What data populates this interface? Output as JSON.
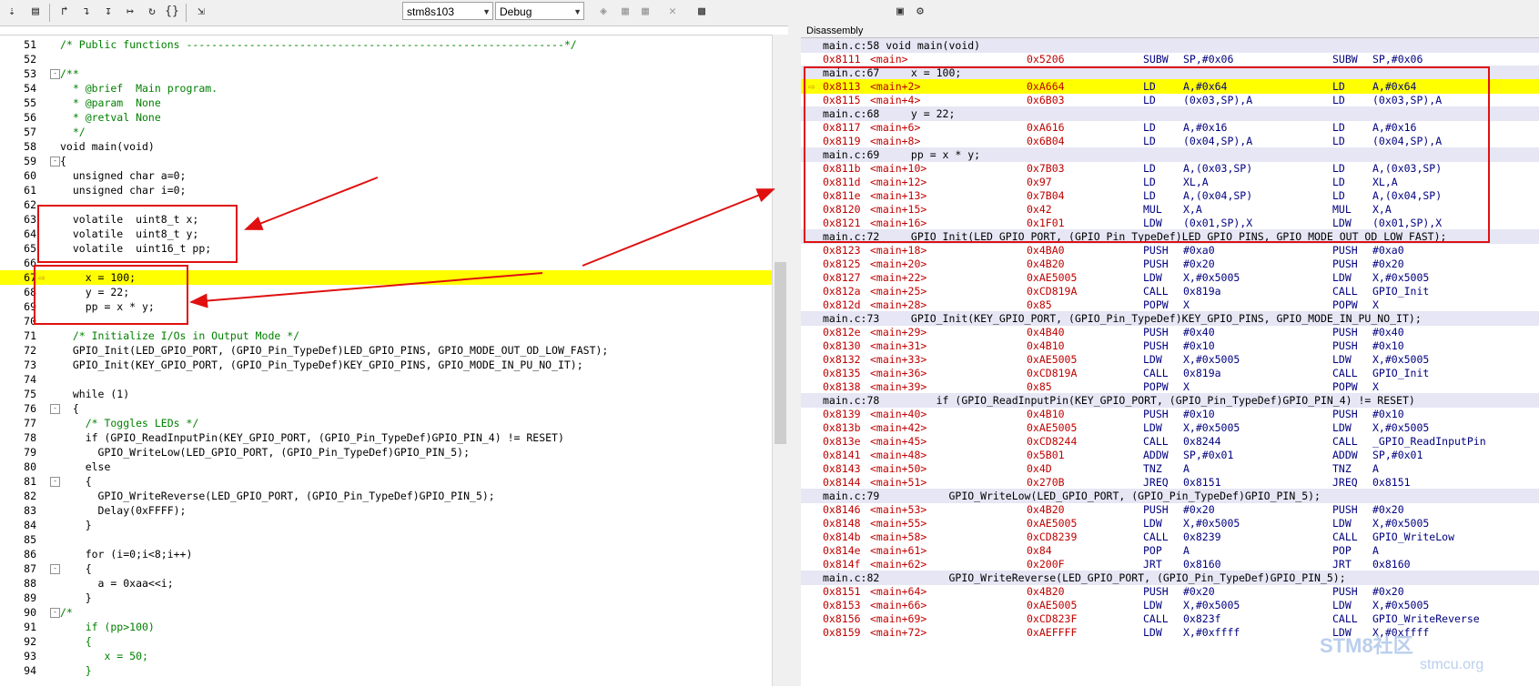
{
  "toolbar": {
    "target_select": "stm8s103",
    "config_select": "Debug",
    "icons": [
      "step-over-icon",
      "step-into-icon",
      "step-out-icon",
      "run-to-cursor-icon",
      "show-next-statement-icon",
      "disassembly-window-icon",
      "memory-window-icon"
    ]
  },
  "editor": {
    "lines": [
      {
        "n": "51",
        "t": "/* Public functions ------------------------------------------------------------*/",
        "k": "comment"
      },
      {
        "n": "52",
        "t": "",
        "k": "code"
      },
      {
        "n": "53",
        "t": "/**",
        "k": "comment",
        "fold": "-"
      },
      {
        "n": "54",
        "t": "  * @brief  Main program.",
        "k": "comment"
      },
      {
        "n": "55",
        "t": "  * @param  None",
        "k": "comment"
      },
      {
        "n": "56",
        "t": "  * @retval None",
        "k": "comment"
      },
      {
        "n": "57",
        "t": "  */",
        "k": "comment"
      },
      {
        "n": "58",
        "t": "void main(void)",
        "k": "code"
      },
      {
        "n": "59",
        "t": "{",
        "k": "code",
        "fold": "-"
      },
      {
        "n": "60",
        "t": "  unsigned char a=0;",
        "k": "code"
      },
      {
        "n": "61",
        "t": "  unsigned char i=0;",
        "k": "code"
      },
      {
        "n": "62",
        "t": "",
        "k": "code"
      },
      {
        "n": "63",
        "t": "  volatile  uint8_t x;",
        "k": "code"
      },
      {
        "n": "64",
        "t": "  volatile  uint8_t y;",
        "k": "code"
      },
      {
        "n": "65",
        "t": "  volatile  uint16_t pp;",
        "k": "code"
      },
      {
        "n": "66",
        "t": "",
        "k": "code"
      },
      {
        "n": "67",
        "t": "    x = 100;",
        "k": "code",
        "cur": true
      },
      {
        "n": "68",
        "t": "    y = 22;",
        "k": "code"
      },
      {
        "n": "69",
        "t": "    pp = x * y;",
        "k": "code"
      },
      {
        "n": "70",
        "t": "",
        "k": "code"
      },
      {
        "n": "71",
        "t": "  /* Initialize I/Os in Output Mode */",
        "k": "comment"
      },
      {
        "n": "72",
        "t": "  GPIO_Init(LED_GPIO_PORT, (GPIO_Pin_TypeDef)LED_GPIO_PINS, GPIO_MODE_OUT_OD_LOW_FAST);",
        "k": "code"
      },
      {
        "n": "73",
        "t": "  GPIO_Init(KEY_GPIO_PORT, (GPIO_Pin_TypeDef)KEY_GPIO_PINS, GPIO_MODE_IN_PU_NO_IT);",
        "k": "code"
      },
      {
        "n": "74",
        "t": "",
        "k": "code"
      },
      {
        "n": "75",
        "t": "  while (1)",
        "k": "code"
      },
      {
        "n": "76",
        "t": "  {",
        "k": "code",
        "fold": "-"
      },
      {
        "n": "77",
        "t": "    /* Toggles LEDs */",
        "k": "comment"
      },
      {
        "n": "78",
        "t": "    if (GPIO_ReadInputPin(KEY_GPIO_PORT, (GPIO_Pin_TypeDef)GPIO_PIN_4) != RESET)",
        "k": "code"
      },
      {
        "n": "79",
        "t": "      GPIO_WriteLow(LED_GPIO_PORT, (GPIO_Pin_TypeDef)GPIO_PIN_5);",
        "k": "code"
      },
      {
        "n": "80",
        "t": "    else",
        "k": "code"
      },
      {
        "n": "81",
        "t": "    {",
        "k": "code",
        "fold": "-"
      },
      {
        "n": "82",
        "t": "      GPIO_WriteReverse(LED_GPIO_PORT, (GPIO_Pin_TypeDef)GPIO_PIN_5);",
        "k": "code"
      },
      {
        "n": "83",
        "t": "      Delay(0xFFFF);",
        "k": "code"
      },
      {
        "n": "84",
        "t": "    }",
        "k": "code"
      },
      {
        "n": "85",
        "t": "",
        "k": "code"
      },
      {
        "n": "86",
        "t": "    for (i=0;i<8;i++)",
        "k": "code"
      },
      {
        "n": "87",
        "t": "    {",
        "k": "code",
        "fold": "-"
      },
      {
        "n": "88",
        "t": "      a = 0xaa<<i;",
        "k": "code"
      },
      {
        "n": "89",
        "t": "    }",
        "k": "code"
      },
      {
        "n": "90",
        "t": "/*",
        "k": "comment",
        "fold": "-"
      },
      {
        "n": "91",
        "t": "    if (pp>100)",
        "k": "comment"
      },
      {
        "n": "92",
        "t": "    {",
        "k": "comment"
      },
      {
        "n": "93",
        "t": "       x = 50;",
        "k": "comment"
      },
      {
        "n": "94",
        "t": "    }",
        "k": "comment"
      }
    ]
  },
  "disassembly": {
    "title": "Disassembly",
    "rows": [
      {
        "type": "src",
        "text": "main.c:58 void main(void)"
      },
      {
        "type": "asm",
        "addr": "0x8111",
        "lab": "<main>",
        "op": "0x5206",
        "mn": "SUBW",
        "arg": "SP,#0x06",
        "mn2": "SUBW",
        "arg2": "SP,#0x06"
      },
      {
        "type": "src",
        "text": "main.c:67     x = 100;"
      },
      {
        "type": "asm",
        "addr": "0x8113",
        "lab": "<main+2>",
        "op": "0xA664",
        "mn": "LD",
        "arg": "A,#0x64",
        "mn2": "LD",
        "arg2": "A,#0x64",
        "cur": true
      },
      {
        "type": "asm",
        "addr": "0x8115",
        "lab": "<main+4>",
        "op": "0x6B03",
        "mn": "LD",
        "arg": "(0x03,SP),A",
        "mn2": "LD",
        "arg2": "(0x03,SP),A"
      },
      {
        "type": "src",
        "text": "main.c:68     y = 22;"
      },
      {
        "type": "asm",
        "addr": "0x8117",
        "lab": "<main+6>",
        "op": "0xA616",
        "mn": "LD",
        "arg": "A,#0x16",
        "mn2": "LD",
        "arg2": "A,#0x16"
      },
      {
        "type": "asm",
        "addr": "0x8119",
        "lab": "<main+8>",
        "op": "0x6B04",
        "mn": "LD",
        "arg": "(0x04,SP),A",
        "mn2": "LD",
        "arg2": "(0x04,SP),A"
      },
      {
        "type": "src",
        "text": "main.c:69     pp = x * y;"
      },
      {
        "type": "asm",
        "addr": "0x811b",
        "lab": "<main+10>",
        "op": "0x7B03",
        "mn": "LD",
        "arg": "A,(0x03,SP)",
        "mn2": "LD",
        "arg2": "A,(0x03,SP)"
      },
      {
        "type": "asm",
        "addr": "0x811d",
        "lab": "<main+12>",
        "op": "0x97",
        "mn": "LD",
        "arg": "XL,A",
        "mn2": "LD",
        "arg2": "XL,A"
      },
      {
        "type": "asm",
        "addr": "0x811e",
        "lab": "<main+13>",
        "op": "0x7B04",
        "mn": "LD",
        "arg": "A,(0x04,SP)",
        "mn2": "LD",
        "arg2": "A,(0x04,SP)"
      },
      {
        "type": "asm",
        "addr": "0x8120",
        "lab": "<main+15>",
        "op": "0x42",
        "mn": "MUL",
        "arg": "X,A",
        "mn2": "MUL",
        "arg2": "X,A"
      },
      {
        "type": "asm",
        "addr": "0x8121",
        "lab": "<main+16>",
        "op": "0x1F01",
        "mn": "LDW",
        "arg": "(0x01,SP),X",
        "mn2": "LDW",
        "arg2": "(0x01,SP),X"
      },
      {
        "type": "src",
        "text": "main.c:72     GPIO_Init(LED_GPIO_PORT, (GPIO_Pin_TypeDef)LED_GPIO_PINS, GPIO_MODE_OUT_OD_LOW_FAST);"
      },
      {
        "type": "asm",
        "addr": "0x8123",
        "lab": "<main+18>",
        "op": "0x4BA0",
        "mn": "PUSH",
        "arg": "#0xa0",
        "mn2": "PUSH",
        "arg2": "#0xa0"
      },
      {
        "type": "asm",
        "addr": "0x8125",
        "lab": "<main+20>",
        "op": "0x4B20",
        "mn": "PUSH",
        "arg": "#0x20",
        "mn2": "PUSH",
        "arg2": "#0x20"
      },
      {
        "type": "asm",
        "addr": "0x8127",
        "lab": "<main+22>",
        "op": "0xAE5005",
        "mn": "LDW",
        "arg": "X,#0x5005",
        "mn2": "LDW",
        "arg2": "X,#0x5005"
      },
      {
        "type": "asm",
        "addr": "0x812a",
        "lab": "<main+25>",
        "op": "0xCD819A",
        "mn": "CALL",
        "arg": "0x819a",
        "mn2": "CALL",
        "arg2": "GPIO_Init"
      },
      {
        "type": "asm",
        "addr": "0x812d",
        "lab": "<main+28>",
        "op": "0x85",
        "mn": "POPW",
        "arg": "X",
        "mn2": "POPW",
        "arg2": "X"
      },
      {
        "type": "src",
        "text": "main.c:73     GPIO_Init(KEY_GPIO_PORT, (GPIO_Pin_TypeDef)KEY_GPIO_PINS, GPIO_MODE_IN_PU_NO_IT);"
      },
      {
        "type": "asm",
        "addr": "0x812e",
        "lab": "<main+29>",
        "op": "0x4B40",
        "mn": "PUSH",
        "arg": "#0x40",
        "mn2": "PUSH",
        "arg2": "#0x40"
      },
      {
        "type": "asm",
        "addr": "0x8130",
        "lab": "<main+31>",
        "op": "0x4B10",
        "mn": "PUSH",
        "arg": "#0x10",
        "mn2": "PUSH",
        "arg2": "#0x10"
      },
      {
        "type": "asm",
        "addr": "0x8132",
        "lab": "<main+33>",
        "op": "0xAE5005",
        "mn": "LDW",
        "arg": "X,#0x5005",
        "mn2": "LDW",
        "arg2": "X,#0x5005"
      },
      {
        "type": "asm",
        "addr": "0x8135",
        "lab": "<main+36>",
        "op": "0xCD819A",
        "mn": "CALL",
        "arg": "0x819a",
        "mn2": "CALL",
        "arg2": "GPIO_Init"
      },
      {
        "type": "asm",
        "addr": "0x8138",
        "lab": "<main+39>",
        "op": "0x85",
        "mn": "POPW",
        "arg": "X",
        "mn2": "POPW",
        "arg2": "X"
      },
      {
        "type": "src",
        "text": "main.c:78         if (GPIO_ReadInputPin(KEY_GPIO_PORT, (GPIO_Pin_TypeDef)GPIO_PIN_4) != RESET)"
      },
      {
        "type": "asm",
        "addr": "0x8139",
        "lab": "<main+40>",
        "op": "0x4B10",
        "mn": "PUSH",
        "arg": "#0x10",
        "mn2": "PUSH",
        "arg2": "#0x10"
      },
      {
        "type": "asm",
        "addr": "0x813b",
        "lab": "<main+42>",
        "op": "0xAE5005",
        "mn": "LDW",
        "arg": "X,#0x5005",
        "mn2": "LDW",
        "arg2": "X,#0x5005"
      },
      {
        "type": "asm",
        "addr": "0x813e",
        "lab": "<main+45>",
        "op": "0xCD8244",
        "mn": "CALL",
        "arg": "0x8244",
        "mn2": "CALL",
        "arg2": "_GPIO_ReadInputPin"
      },
      {
        "type": "asm",
        "addr": "0x8141",
        "lab": "<main+48>",
        "op": "0x5B01",
        "mn": "ADDW",
        "arg": "SP,#0x01",
        "mn2": "ADDW",
        "arg2": "SP,#0x01"
      },
      {
        "type": "asm",
        "addr": "0x8143",
        "lab": "<main+50>",
        "op": "0x4D",
        "mn": "TNZ",
        "arg": "A",
        "mn2": "TNZ",
        "arg2": "A"
      },
      {
        "type": "asm",
        "addr": "0x8144",
        "lab": "<main+51>",
        "op": "0x270B",
        "mn": "JREQ",
        "arg": "0x8151",
        "mn2": "JREQ",
        "arg2": "0x8151"
      },
      {
        "type": "src",
        "text": "main.c:79           GPIO_WriteLow(LED_GPIO_PORT, (GPIO_Pin_TypeDef)GPIO_PIN_5);"
      },
      {
        "type": "asm",
        "addr": "0x8146",
        "lab": "<main+53>",
        "op": "0x4B20",
        "mn": "PUSH",
        "arg": "#0x20",
        "mn2": "PUSH",
        "arg2": "#0x20"
      },
      {
        "type": "asm",
        "addr": "0x8148",
        "lab": "<main+55>",
        "op": "0xAE5005",
        "mn": "LDW",
        "arg": "X,#0x5005",
        "mn2": "LDW",
        "arg2": "X,#0x5005"
      },
      {
        "type": "asm",
        "addr": "0x814b",
        "lab": "<main+58>",
        "op": "0xCD8239",
        "mn": "CALL",
        "arg": "0x8239",
        "mn2": "CALL",
        "arg2": "GPIO_WriteLow"
      },
      {
        "type": "asm",
        "addr": "0x814e",
        "lab": "<main+61>",
        "op": "0x84",
        "mn": "POP",
        "arg": "A",
        "mn2": "POP",
        "arg2": "A"
      },
      {
        "type": "asm",
        "addr": "0x814f",
        "lab": "<main+62>",
        "op": "0x200F",
        "mn": "JRT",
        "arg": "0x8160",
        "mn2": "JRT",
        "arg2": "0x8160"
      },
      {
        "type": "src",
        "text": "main.c:82           GPIO_WriteReverse(LED_GPIO_PORT, (GPIO_Pin_TypeDef)GPIO_PIN_5);"
      },
      {
        "type": "asm",
        "addr": "0x8151",
        "lab": "<main+64>",
        "op": "0x4B20",
        "mn": "PUSH",
        "arg": "#0x20",
        "mn2": "PUSH",
        "arg2": "#0x20"
      },
      {
        "type": "asm",
        "addr": "0x8153",
        "lab": "<main+66>",
        "op": "0xAE5005",
        "mn": "LDW",
        "arg": "X,#0x5005",
        "mn2": "LDW",
        "arg2": "X,#0x5005"
      },
      {
        "type": "asm",
        "addr": "0x8156",
        "lab": "<main+69>",
        "op": "0xCD823F",
        "mn": "CALL",
        "arg": "0x823f",
        "mn2": "CALL",
        "arg2": "GPIO_WriteReverse"
      },
      {
        "type": "asm",
        "addr": "0x8159",
        "lab": "<main+72>",
        "op": "0xAEFFFF",
        "mn": "LDW",
        "arg": "X,#0xffff",
        "mn2": "LDW",
        "arg2": "X,#0xffff"
      }
    ]
  },
  "watermark": {
    "line1": "STM8社区",
    "line2": "stmcu.org"
  },
  "colors": {
    "current_line": "#ffff00",
    "annotation": "#e01010",
    "source_row": "#e6e6f5"
  }
}
